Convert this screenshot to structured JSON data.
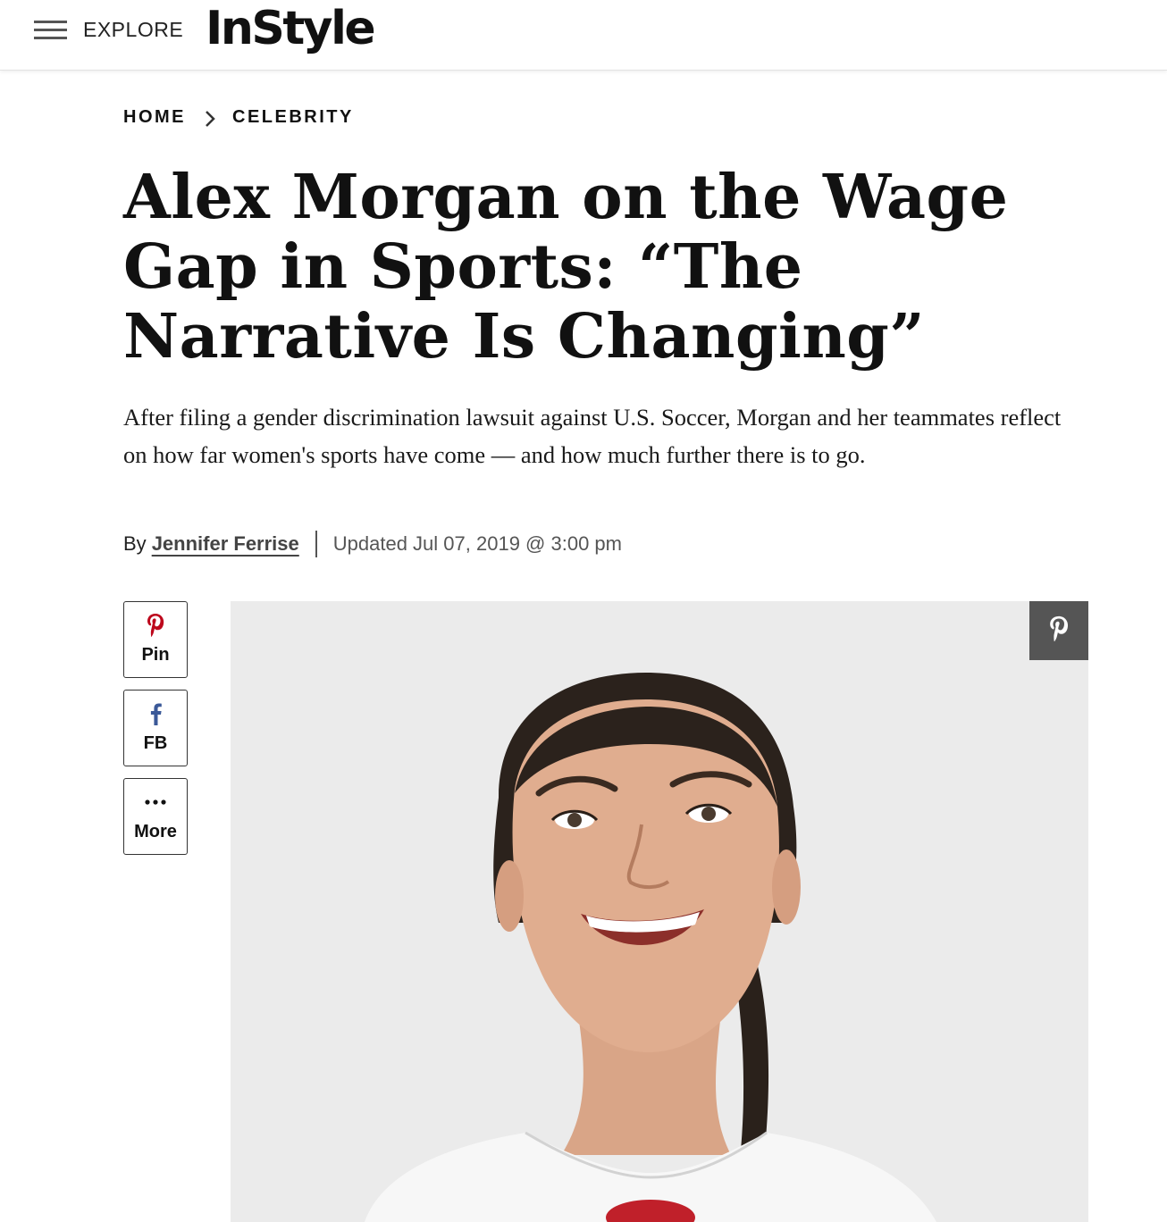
{
  "header": {
    "menu_icon": "hamburger-icon",
    "explore_label": "EXPLORE",
    "logo_text": "InStyle"
  },
  "breadcrumb": {
    "items": [
      "HOME",
      "CELEBRITY"
    ],
    "separator_icon": "chevron-right-icon"
  },
  "article": {
    "headline": "Alex Morgan on the Wage Gap in Sports: “The Narrative Is Changing”",
    "dek": "After filing a gender discrimination lawsuit against U.S. Soccer, Morgan and her teammates reflect on how far women's sports have come — and how much further there is to go.",
    "byline_prefix": "By",
    "author": "Jennifer Ferrise",
    "updated": "Updated Jul 07, 2019 @ 3:00 pm"
  },
  "share": {
    "pin_label": "Pin",
    "fb_label": "FB",
    "more_label": "More"
  },
  "colors": {
    "pinterest_red": "#bd081c",
    "facebook_blue": "#3b5998",
    "overlay_gray": "#555555"
  }
}
